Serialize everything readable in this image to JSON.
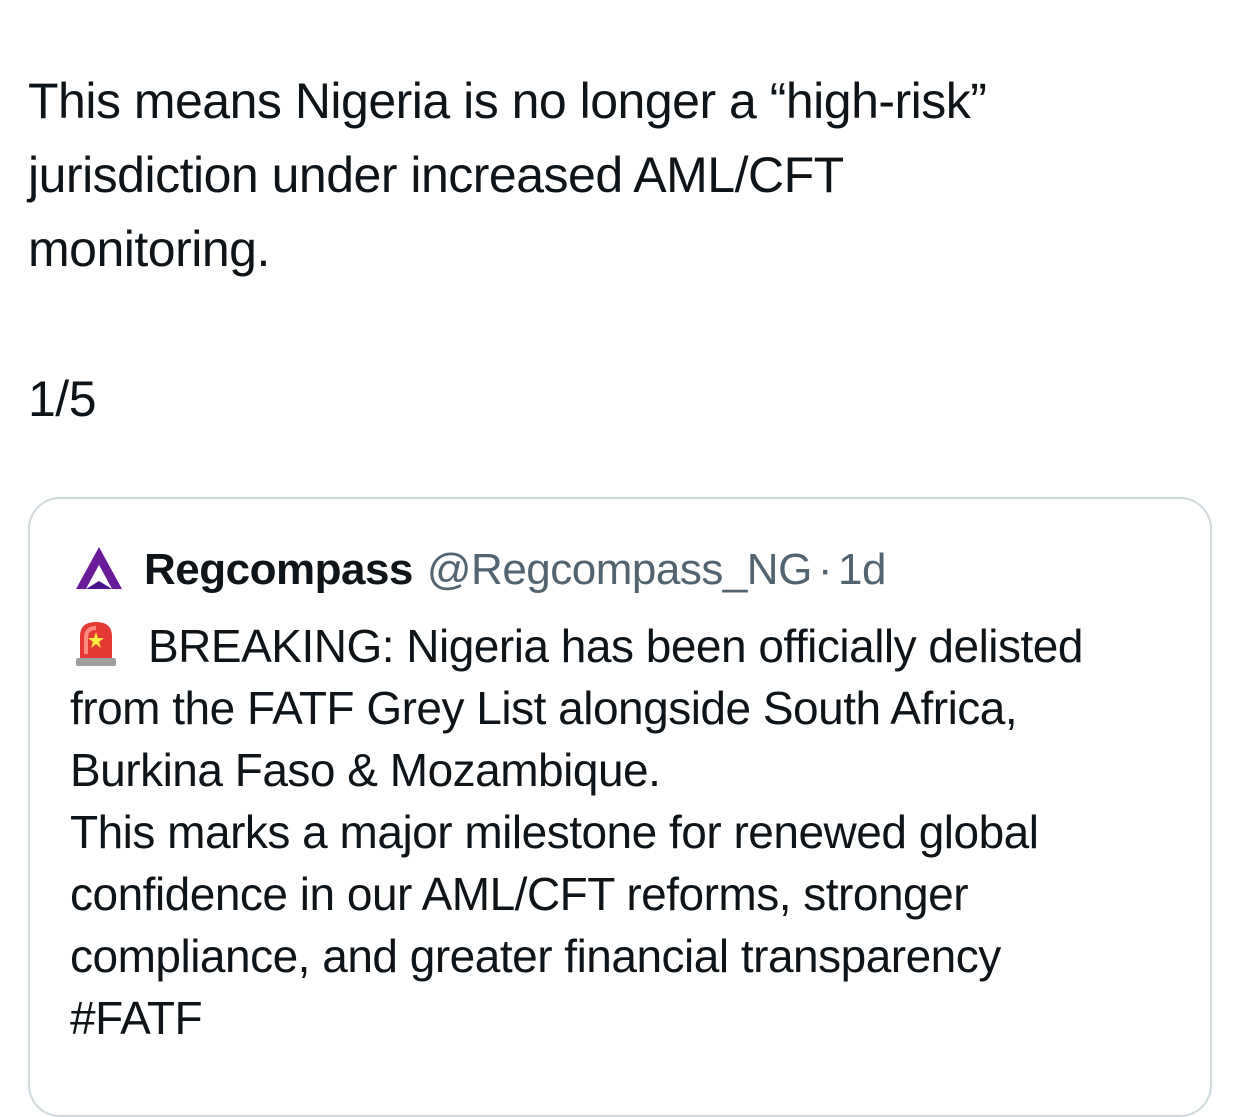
{
  "tweet": {
    "text_lines": [
      "This means Nigeria is no longer a “high-risk”",
      "jurisdiction under increased AML/CFT",
      "monitoring."
    ],
    "thread_count": "1/5"
  },
  "quoted_tweet": {
    "author_name": "Regcompass",
    "author_handle": "@Regcompass_NG",
    "separator": "·",
    "time": "1d",
    "avatar_icon": "regcompass-logo-icon",
    "emoji_icon": "police-siren-icon",
    "text_lines": [
      "BREAKING: Nigeria has been officially delisted",
      "from the FATF Grey List alongside South Africa,",
      "Burkina Faso & Mozambique.",
      "This marks a major milestone for renewed global",
      "confidence in our AML/CFT reforms, stronger",
      "compliance, and greater financial transparency",
      "#FATF"
    ]
  },
  "colors": {
    "text_primary": "#0f1419",
    "text_secondary": "#536471",
    "border": "#cfd9de",
    "logo_purple": "#6a1b9a"
  }
}
